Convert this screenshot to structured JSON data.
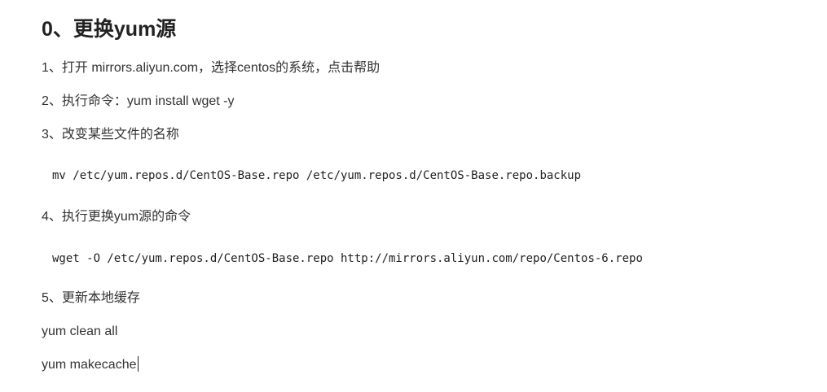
{
  "heading": "0、更换yum源",
  "steps": [
    "1、打开 mirrors.aliyun.com，选择centos的系统，点击帮助",
    "2、执行命令：yum install wget -y",
    "3、改变某些文件的名称",
    "4、执行更换yum源的命令",
    "5、更新本地缓存"
  ],
  "code": [
    "mv /etc/yum.repos.d/CentOS-Base.repo /etc/yum.repos.d/CentOS-Base.repo.backup",
    "wget -O /etc/yum.repos.d/CentOS-Base.repo http://mirrors.aliyun.com/repo/Centos-6.repo"
  ],
  "commands": [
    "yum clean all",
    "yum makecache"
  ]
}
